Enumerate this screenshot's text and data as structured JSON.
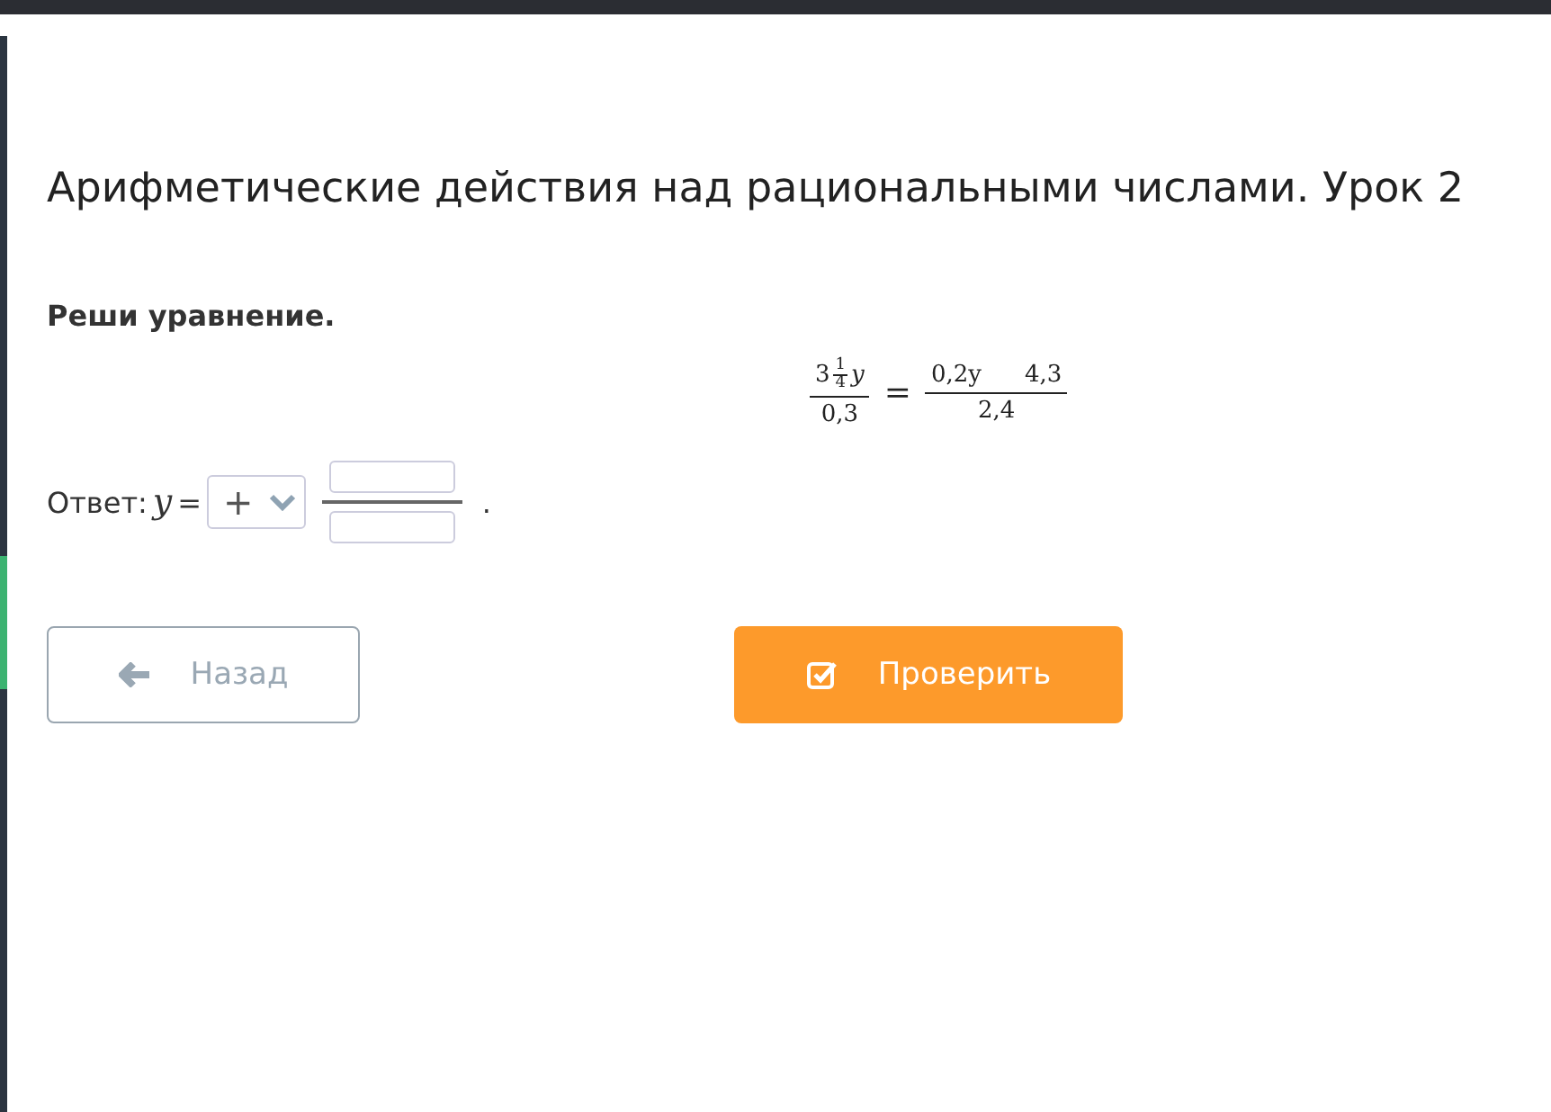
{
  "title": "Арифметические действия над рациональными числами. Урок 2",
  "task": "Реши уравнение.",
  "equation": {
    "left": {
      "whole": "3",
      "frac_numerator": "1",
      "frac_denominator": "4",
      "variable": "y",
      "denominator": "0,3"
    },
    "relation": "=",
    "right": {
      "numerator_terms": [
        "0,2y",
        "4,3"
      ],
      "denominator": "2,4"
    }
  },
  "answer": {
    "label": "Ответ:",
    "variable": "y",
    "equals": "=",
    "sign": "+",
    "end": "."
  },
  "buttons": [
    {
      "kind": "back",
      "label": "Назад",
      "disabled": true
    },
    {
      "kind": "check",
      "label": "Проверить",
      "disabled": false
    }
  ]
}
